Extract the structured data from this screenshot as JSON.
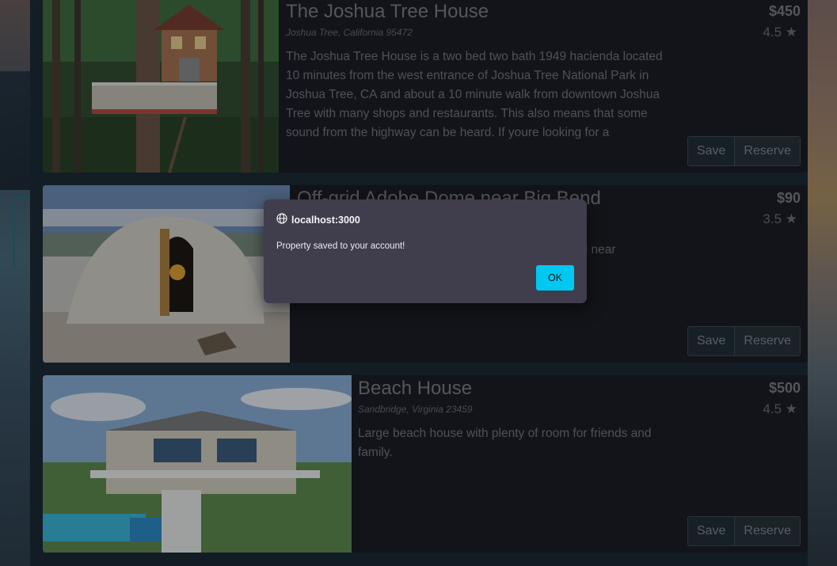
{
  "listings": [
    {
      "title": "The Joshua Tree House",
      "address": "Joshua Tree, California 95472",
      "price": "$450",
      "rating": "4.5 ★",
      "description": "The Joshua Tree House is a two bed two bath 1949 hacienda located 10 minutes from the west entrance of Joshua Tree National Park in Joshua Tree, CA and about a 10 minute walk from downtown Joshua Tree with many shops and restaurants. This also means that some sound from the highway can be heard. If youre looking for a",
      "image": "treehouse-photo",
      "save_label": "Save",
      "reserve_label": "Reserve"
    },
    {
      "title": "Off-grid Adobe Dome near Big Bend",
      "address": "",
      "price": "$90",
      "rating": "3.5 ★",
      "description": "ower, and near",
      "image": "adobe-dome-photo",
      "save_label": "Save",
      "reserve_label": "Reserve"
    },
    {
      "title": "Beach House",
      "address": "Sandbridge, Virginia 23459",
      "price": "$500",
      "rating": "4.5 ★",
      "description": "Large beach house with plenty of room for friends and family.",
      "image": "beach-house-photo",
      "save_label": "Save",
      "reserve_label": "Reserve"
    }
  ],
  "dialog": {
    "origin": "localhost:3000",
    "message": "Property saved to your account!",
    "ok_label": "OK",
    "icon": "globe-icon"
  },
  "colors": {
    "card_bg": "#18181d",
    "dialog_bg": "#403d4c",
    "ok_button": "#00c8f0"
  }
}
